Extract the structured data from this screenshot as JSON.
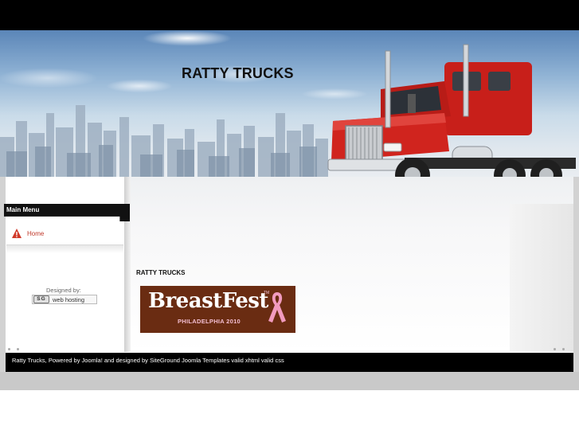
{
  "site": {
    "title": "RATTY TRUCKS"
  },
  "sidebar": {
    "menu_title": "Main Menu",
    "items": [
      {
        "label": "Home",
        "icon": "warning-triangle-icon"
      }
    ],
    "designed_by_label": "Designed by:",
    "credit": {
      "logo_text": "SG",
      "link_label": "web hosting"
    }
  },
  "content": {
    "heading": "RATTY TRUCKS",
    "banner": {
      "brand": "BreastFest",
      "tm": "TM",
      "subtitle": "PHILADELPHIA 2010",
      "ribbon_icon": "pink-ribbon-icon"
    }
  },
  "footer": {
    "text": "Ratty Trucks, Powered by Joomla! and designed by SiteGround Joomla Templates valid xhtml valid css"
  },
  "colors": {
    "top_bar": "#000000",
    "menu_link": "#c0392b",
    "banner_bg": "#6a2c12",
    "ribbon": "#f19bbf",
    "truck_red": "#d0241e"
  }
}
